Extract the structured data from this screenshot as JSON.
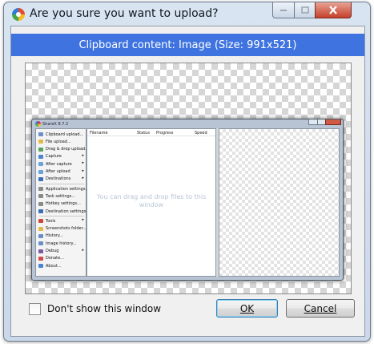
{
  "window": {
    "title": "Are you sure you want to upload?"
  },
  "banner": {
    "text": "Clipboard content: Image (Size: 991x521)"
  },
  "preview": {
    "sharex_window": {
      "title": "ShareX 8.7.2",
      "menu_items": [
        {
          "label": "Clipboard upload...",
          "icon_color": "#6a8fc7",
          "arrow": false
        },
        {
          "label": "File upload...",
          "icon_color": "#e6b84a",
          "arrow": false
        },
        {
          "label": "Drag & drop upload...",
          "icon_color": "#5aa05a",
          "arrow": false
        },
        {
          "label": "Capture",
          "icon_color": "#4a86d0",
          "arrow": true
        },
        {
          "label": "After capture",
          "icon_color": "#68a4d8",
          "arrow": true
        },
        {
          "label": "After upload",
          "icon_color": "#68a4d8",
          "arrow": true
        },
        {
          "label": "Destinations",
          "icon_color": "#3a6fb8",
          "arrow": true
        },
        {
          "label": "Application settings...",
          "icon_color": "#8a8a8a",
          "arrow": false
        },
        {
          "label": "Task settings...",
          "icon_color": "#8a8a8a",
          "arrow": false
        },
        {
          "label": "Hotkey settings...",
          "icon_color": "#8a8a8a",
          "arrow": false
        },
        {
          "label": "Destination settings...",
          "icon_color": "#3a6fb8",
          "arrow": false
        },
        {
          "label": "Tools",
          "icon_color": "#c84a3a",
          "arrow": true
        },
        {
          "label": "Screenshots folder...",
          "icon_color": "#e6b84a",
          "arrow": false
        },
        {
          "label": "History...",
          "icon_color": "#6a8fc7",
          "arrow": false
        },
        {
          "label": "Image history...",
          "icon_color": "#6a8fc7",
          "arrow": false
        },
        {
          "label": "Debug",
          "icon_color": "#7a5aa0",
          "arrow": true
        },
        {
          "label": "Donate...",
          "icon_color": "#d04a4a",
          "arrow": false
        },
        {
          "label": "About...",
          "icon_color": "#4a86d0",
          "arrow": false
        }
      ],
      "columns": [
        "Filename",
        "Status",
        "Progress",
        "Speed"
      ],
      "hint": "You can drag and drop files to this window"
    }
  },
  "checkbox": {
    "label": "Don't show this window",
    "checked": false
  },
  "buttons": {
    "ok": {
      "label": "OK"
    },
    "cancel": {
      "label": "Cancel"
    }
  },
  "colors": {
    "banner": "#3f74e0",
    "close_button": "#c4412c"
  }
}
